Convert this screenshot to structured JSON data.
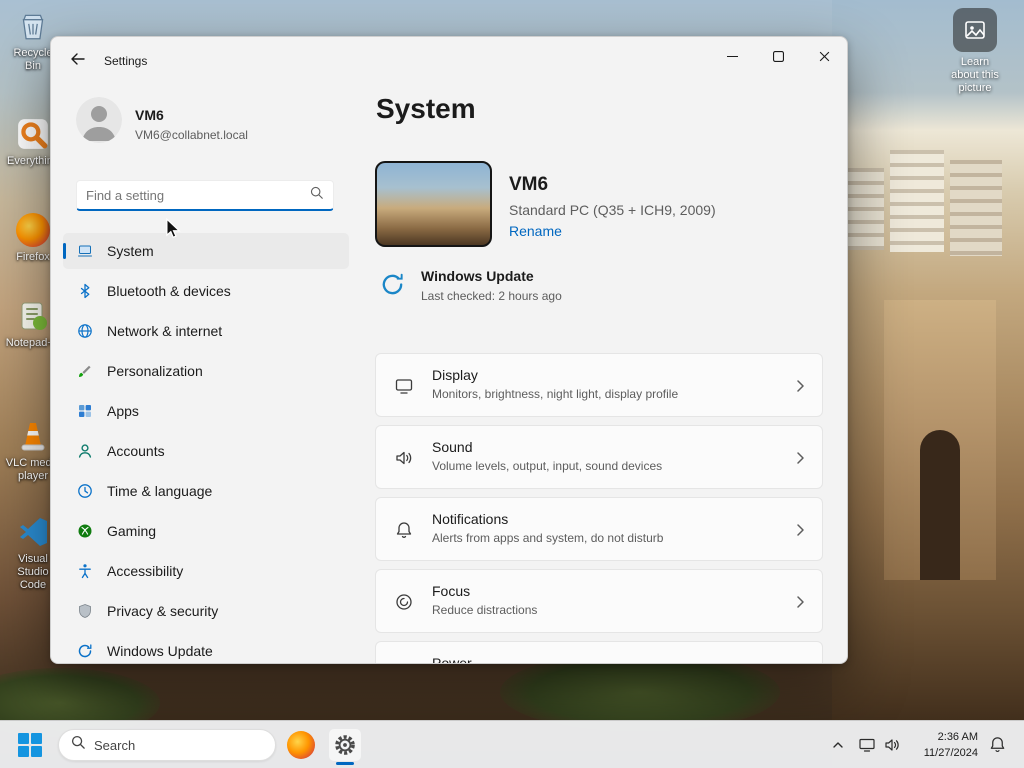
{
  "colors": {
    "accent": "#0067c0",
    "window_bg": "#f3f3f3",
    "card_bg": "#fbfbfb"
  },
  "desktop": {
    "spotlight_label": "Learn about this picture",
    "icons": [
      {
        "label": "Recycle Bin"
      },
      {
        "label": "Everything"
      },
      {
        "label": "Firefox"
      },
      {
        "label": "Notepad++"
      },
      {
        "label": "VLC media player"
      },
      {
        "label": "Visual Studio Code"
      }
    ]
  },
  "window": {
    "title": "Settings",
    "user": {
      "name": "VM6",
      "email": "VM6@collabnet.local"
    },
    "search": {
      "placeholder": "Find a setting"
    },
    "nav": [
      {
        "label": "System"
      },
      {
        "label": "Bluetooth & devices"
      },
      {
        "label": "Network & internet"
      },
      {
        "label": "Personalization"
      },
      {
        "label": "Apps"
      },
      {
        "label": "Accounts"
      },
      {
        "label": "Time & language"
      },
      {
        "label": "Gaming"
      },
      {
        "label": "Accessibility"
      },
      {
        "label": "Privacy & security"
      },
      {
        "label": "Windows Update"
      }
    ],
    "page": {
      "title": "System",
      "device": {
        "name": "VM6",
        "model": "Standard PC (Q35 + ICH9, 2009)",
        "rename_label": "Rename"
      },
      "windows_update": {
        "title": "Windows Update",
        "status": "Last checked: 2 hours ago"
      },
      "cards": [
        {
          "title": "Display",
          "subtitle": "Monitors, brightness, night light, display profile"
        },
        {
          "title": "Sound",
          "subtitle": "Volume levels, output, input, sound devices"
        },
        {
          "title": "Notifications",
          "subtitle": "Alerts from apps and system, do not disturb"
        },
        {
          "title": "Focus",
          "subtitle": "Reduce distractions"
        },
        {
          "title": "Power",
          "subtitle": ""
        }
      ]
    }
  },
  "taskbar": {
    "search_label": "Search",
    "clock": {
      "time": "2:36 AM",
      "date": "11/27/2024"
    }
  }
}
